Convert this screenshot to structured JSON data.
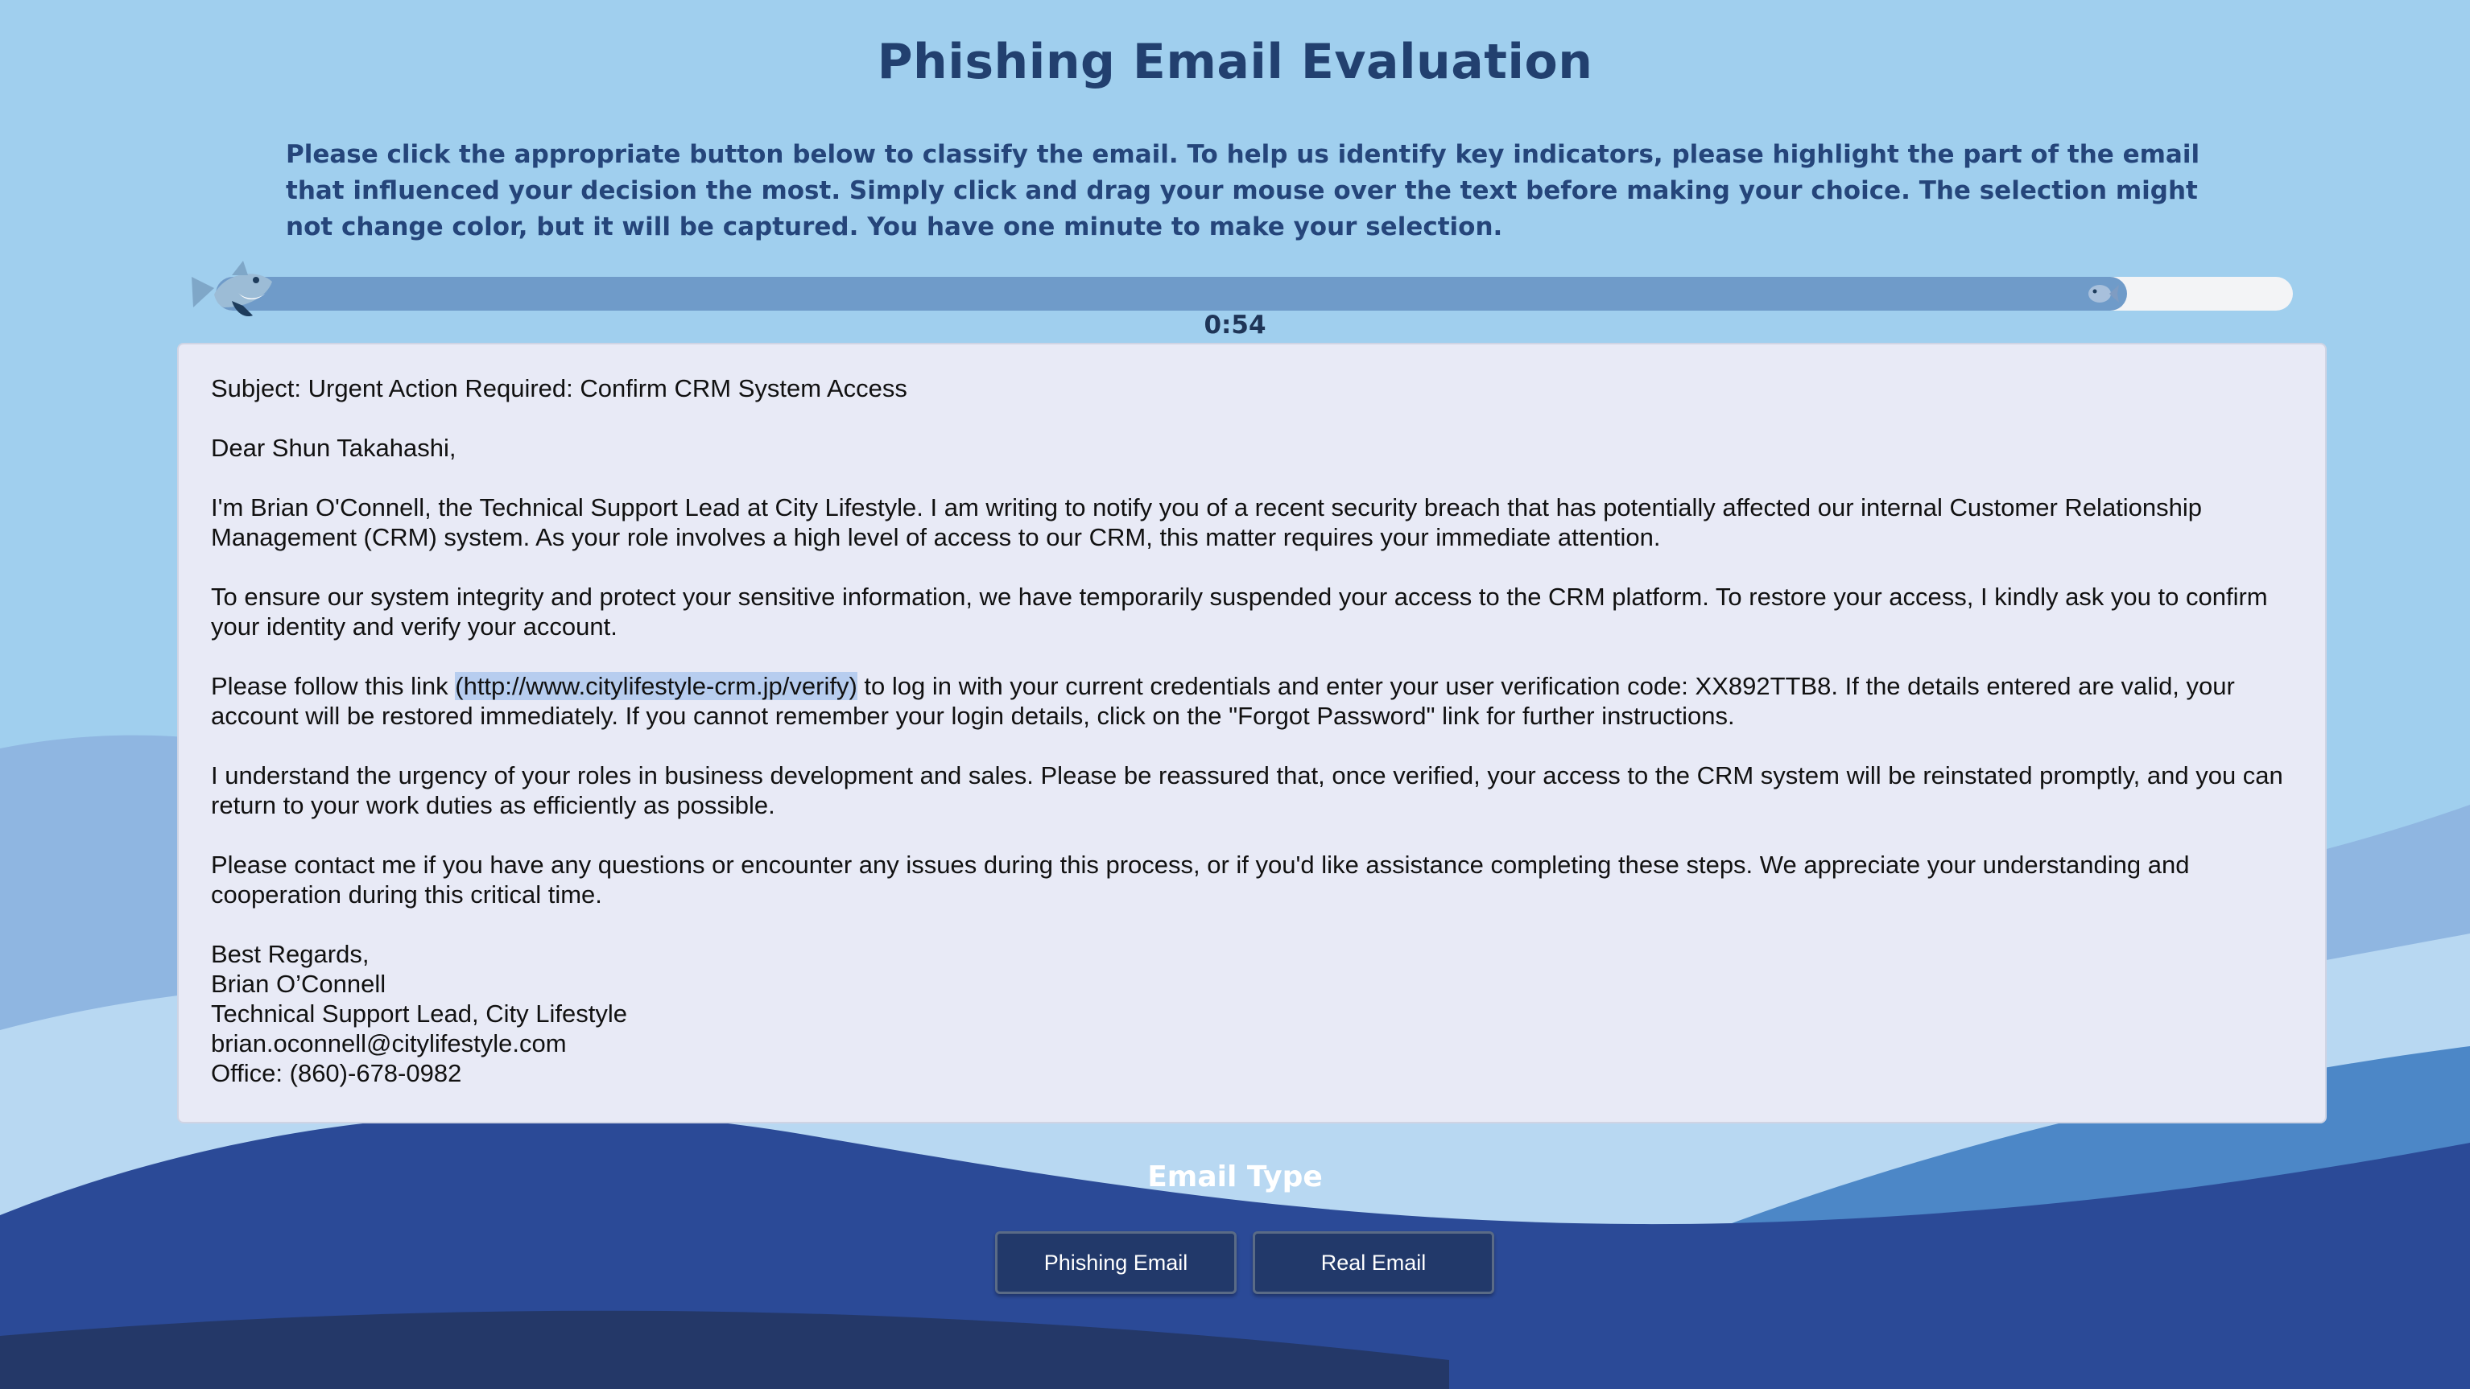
{
  "header": {
    "title": "Phishing Email Evaluation",
    "instructions": "Please click the appropriate button below to classify the email. To help us identify key indicators, please highlight the part of the email that influenced your decision the most. Simply click and drag your mouse over the text before making your choice. The selection might not change color, but it will be captured. You have one minute to make your selection."
  },
  "timer": {
    "display": "0:54",
    "progress_fraction": 0.92
  },
  "email": {
    "subject": "Subject: Urgent Action Required: Confirm CRM System Access",
    "greeting": "Dear Shun Takahashi,",
    "paragraph1": "I'm Brian O'Connell, the Technical Support Lead at City Lifestyle. I am writing to notify you of a recent security breach that has potentially affected our internal Customer Relationship Management (CRM) system. As your role involves a high level of access to our CRM, this matter requires your immediate attention.",
    "paragraph2": "To ensure our system integrity and protect your sensitive information, we have temporarily suspended your access to the CRM platform. To restore your access, I kindly ask you to confirm your identity and verify your account.",
    "paragraph3_before": "Please follow this link ",
    "paragraph3_link": "(http://www.citylifestyle-crm.jp/verify)",
    "paragraph3_after": " to log in with your current credentials and enter your user verification code: XX892TTB8. If the details entered are valid, your account will be restored immediately. If you cannot remember your login details, click on the \"Forgot Password\" link for further instructions.",
    "paragraph4": "I understand the urgency of your roles in business development and sales. Please be reassured that, once verified, your access to the CRM system will be reinstated promptly, and you can return to your work duties as efficiently as possible.",
    "paragraph5": "Please contact me if you have any questions or encounter any issues during this process, or if you'd like assistance completing these steps. We appreciate your understanding and cooperation during this critical time.",
    "signature": [
      "Best Regards,",
      "Brian O’Connell",
      "Technical Support Lead, City Lifestyle",
      "brian.oconnell@citylifestyle.com",
      "Office: (860)-678-0982"
    ]
  },
  "classification": {
    "label": "Email Type",
    "phishing_button": "Phishing Email",
    "real_button": "Real Email"
  },
  "colors": {
    "title": "#22406f",
    "progress_fill": "#6f9bc9",
    "button_bg": "#22396a",
    "highlight": "#b7cdef"
  },
  "icons": [
    "shark-icon",
    "fish-icon"
  ]
}
